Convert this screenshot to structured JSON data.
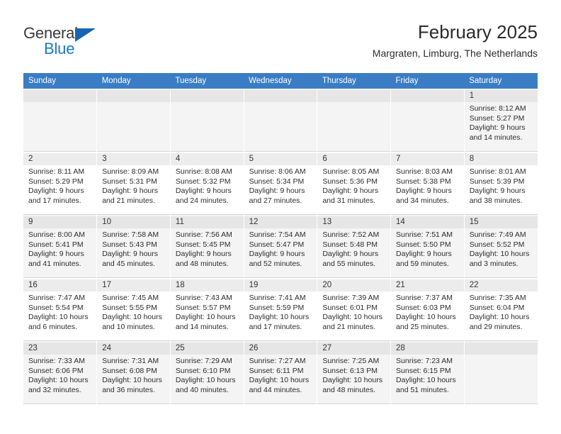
{
  "logo": {
    "primary_text": "General",
    "secondary_text": "Blue",
    "triangle_icon": "blue-triangle-icon",
    "accent_color": "#1a78c8"
  },
  "header": {
    "title": "February 2025",
    "subtitle": "Margraten, Limburg, The Netherlands"
  },
  "theme": {
    "header_row_color": "#3a7dc4",
    "day_number_band": "#ececec",
    "alt_row_background": "#f4f4f4"
  },
  "calendar": {
    "weekday_headers": [
      "Sunday",
      "Monday",
      "Tuesday",
      "Wednesday",
      "Thursday",
      "Friday",
      "Saturday"
    ],
    "labels": {
      "sunrise": "Sunrise:",
      "sunset": "Sunset:",
      "daylight": "Daylight:"
    },
    "weeks": [
      [
        {
          "day": "",
          "sunrise": "",
          "sunset": "",
          "daylight": ""
        },
        {
          "day": "",
          "sunrise": "",
          "sunset": "",
          "daylight": ""
        },
        {
          "day": "",
          "sunrise": "",
          "sunset": "",
          "daylight": ""
        },
        {
          "day": "",
          "sunrise": "",
          "sunset": "",
          "daylight": ""
        },
        {
          "day": "",
          "sunrise": "",
          "sunset": "",
          "daylight": ""
        },
        {
          "day": "",
          "sunrise": "",
          "sunset": "",
          "daylight": ""
        },
        {
          "day": "1",
          "sunrise": "Sunrise: 8:12 AM",
          "sunset": "Sunset: 5:27 PM",
          "daylight": "Daylight: 9 hours and 14 minutes."
        }
      ],
      [
        {
          "day": "2",
          "sunrise": "Sunrise: 8:11 AM",
          "sunset": "Sunset: 5:29 PM",
          "daylight": "Daylight: 9 hours and 17 minutes."
        },
        {
          "day": "3",
          "sunrise": "Sunrise: 8:09 AM",
          "sunset": "Sunset: 5:31 PM",
          "daylight": "Daylight: 9 hours and 21 minutes."
        },
        {
          "day": "4",
          "sunrise": "Sunrise: 8:08 AM",
          "sunset": "Sunset: 5:32 PM",
          "daylight": "Daylight: 9 hours and 24 minutes."
        },
        {
          "day": "5",
          "sunrise": "Sunrise: 8:06 AM",
          "sunset": "Sunset: 5:34 PM",
          "daylight": "Daylight: 9 hours and 27 minutes."
        },
        {
          "day": "6",
          "sunrise": "Sunrise: 8:05 AM",
          "sunset": "Sunset: 5:36 PM",
          "daylight": "Daylight: 9 hours and 31 minutes."
        },
        {
          "day": "7",
          "sunrise": "Sunrise: 8:03 AM",
          "sunset": "Sunset: 5:38 PM",
          "daylight": "Daylight: 9 hours and 34 minutes."
        },
        {
          "day": "8",
          "sunrise": "Sunrise: 8:01 AM",
          "sunset": "Sunset: 5:39 PM",
          "daylight": "Daylight: 9 hours and 38 minutes."
        }
      ],
      [
        {
          "day": "9",
          "sunrise": "Sunrise: 8:00 AM",
          "sunset": "Sunset: 5:41 PM",
          "daylight": "Daylight: 9 hours and 41 minutes."
        },
        {
          "day": "10",
          "sunrise": "Sunrise: 7:58 AM",
          "sunset": "Sunset: 5:43 PM",
          "daylight": "Daylight: 9 hours and 45 minutes."
        },
        {
          "day": "11",
          "sunrise": "Sunrise: 7:56 AM",
          "sunset": "Sunset: 5:45 PM",
          "daylight": "Daylight: 9 hours and 48 minutes."
        },
        {
          "day": "12",
          "sunrise": "Sunrise: 7:54 AM",
          "sunset": "Sunset: 5:47 PM",
          "daylight": "Daylight: 9 hours and 52 minutes."
        },
        {
          "day": "13",
          "sunrise": "Sunrise: 7:52 AM",
          "sunset": "Sunset: 5:48 PM",
          "daylight": "Daylight: 9 hours and 55 minutes."
        },
        {
          "day": "14",
          "sunrise": "Sunrise: 7:51 AM",
          "sunset": "Sunset: 5:50 PM",
          "daylight": "Daylight: 9 hours and 59 minutes."
        },
        {
          "day": "15",
          "sunrise": "Sunrise: 7:49 AM",
          "sunset": "Sunset: 5:52 PM",
          "daylight": "Daylight: 10 hours and 3 minutes."
        }
      ],
      [
        {
          "day": "16",
          "sunrise": "Sunrise: 7:47 AM",
          "sunset": "Sunset: 5:54 PM",
          "daylight": "Daylight: 10 hours and 6 minutes."
        },
        {
          "day": "17",
          "sunrise": "Sunrise: 7:45 AM",
          "sunset": "Sunset: 5:55 PM",
          "daylight": "Daylight: 10 hours and 10 minutes."
        },
        {
          "day": "18",
          "sunrise": "Sunrise: 7:43 AM",
          "sunset": "Sunset: 5:57 PM",
          "daylight": "Daylight: 10 hours and 14 minutes."
        },
        {
          "day": "19",
          "sunrise": "Sunrise: 7:41 AM",
          "sunset": "Sunset: 5:59 PM",
          "daylight": "Daylight: 10 hours and 17 minutes."
        },
        {
          "day": "20",
          "sunrise": "Sunrise: 7:39 AM",
          "sunset": "Sunset: 6:01 PM",
          "daylight": "Daylight: 10 hours and 21 minutes."
        },
        {
          "day": "21",
          "sunrise": "Sunrise: 7:37 AM",
          "sunset": "Sunset: 6:03 PM",
          "daylight": "Daylight: 10 hours and 25 minutes."
        },
        {
          "day": "22",
          "sunrise": "Sunrise: 7:35 AM",
          "sunset": "Sunset: 6:04 PM",
          "daylight": "Daylight: 10 hours and 29 minutes."
        }
      ],
      [
        {
          "day": "23",
          "sunrise": "Sunrise: 7:33 AM",
          "sunset": "Sunset: 6:06 PM",
          "daylight": "Daylight: 10 hours and 32 minutes."
        },
        {
          "day": "24",
          "sunrise": "Sunrise: 7:31 AM",
          "sunset": "Sunset: 6:08 PM",
          "daylight": "Daylight: 10 hours and 36 minutes."
        },
        {
          "day": "25",
          "sunrise": "Sunrise: 7:29 AM",
          "sunset": "Sunset: 6:10 PM",
          "daylight": "Daylight: 10 hours and 40 minutes."
        },
        {
          "day": "26",
          "sunrise": "Sunrise: 7:27 AM",
          "sunset": "Sunset: 6:11 PM",
          "daylight": "Daylight: 10 hours and 44 minutes."
        },
        {
          "day": "27",
          "sunrise": "Sunrise: 7:25 AM",
          "sunset": "Sunset: 6:13 PM",
          "daylight": "Daylight: 10 hours and 48 minutes."
        },
        {
          "day": "28",
          "sunrise": "Sunrise: 7:23 AM",
          "sunset": "Sunset: 6:15 PM",
          "daylight": "Daylight: 10 hours and 51 minutes."
        },
        {
          "day": "",
          "sunrise": "",
          "sunset": "",
          "daylight": ""
        }
      ]
    ]
  }
}
